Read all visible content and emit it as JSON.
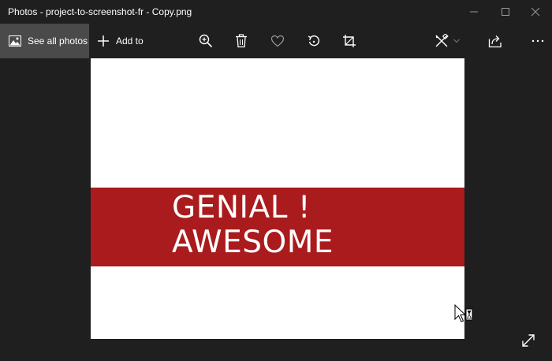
{
  "window": {
    "title": "Photos - project-to-screenshot-fr - Copy.png"
  },
  "toolbar": {
    "see_all_label": "See all photos",
    "add_to_label": "Add to"
  },
  "image": {
    "line1": "GENIAL !",
    "line2": "AWESOME",
    "band_color": "#a91b1d",
    "background_color": "#ffffff"
  },
  "icons": {
    "see_all": "picture-icon",
    "add_to": "plus-icon",
    "zoom": "zoom-in-icon",
    "delete": "trash-icon",
    "favorite": "heart-icon",
    "rotate": "rotate-icon",
    "crop": "crop-icon",
    "edit": "draw-edit-icon",
    "share": "share-icon",
    "more": "more-icon",
    "fullscreen": "expand-icon"
  }
}
